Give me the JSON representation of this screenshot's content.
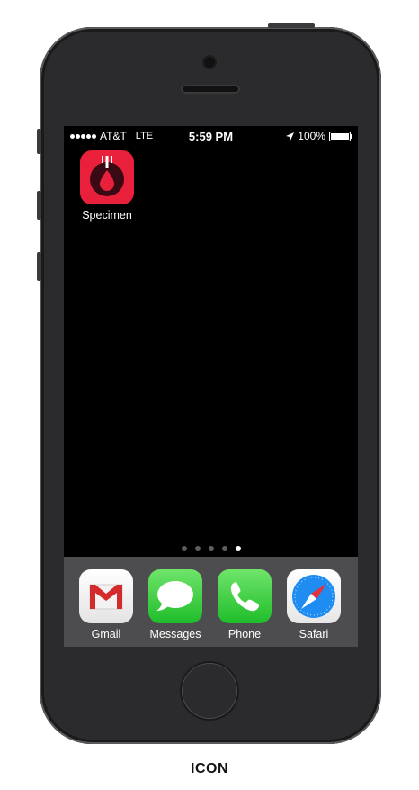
{
  "status_bar": {
    "signal_dots": 5,
    "carrier": "AT&T",
    "network": "LTE",
    "time": "5:59 PM",
    "location_icon": "location-arrow-icon",
    "battery_percent": "100%"
  },
  "home_apps": [
    {
      "label": "Specimen",
      "icon": "specimen-icon",
      "color": "#e8203c"
    }
  ],
  "page_indicator": {
    "count": 5,
    "active_index": 4
  },
  "dock_apps": [
    {
      "label": "Gmail",
      "icon": "gmail-icon"
    },
    {
      "label": "Messages",
      "icon": "messages-icon"
    },
    {
      "label": "Phone",
      "icon": "phone-icon"
    },
    {
      "label": "Safari",
      "icon": "safari-icon"
    }
  ],
  "caption": "ICON"
}
